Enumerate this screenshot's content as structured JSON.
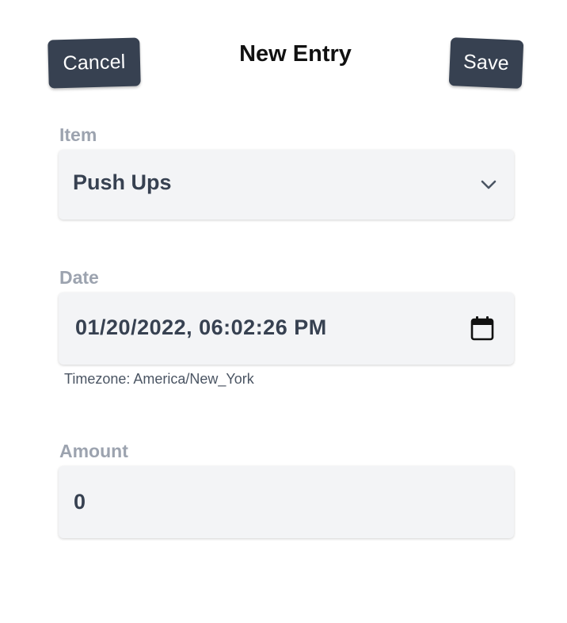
{
  "header": {
    "title": "New Entry",
    "cancel_label": "Cancel",
    "save_label": "Save"
  },
  "form": {
    "item": {
      "label": "Item",
      "value": "Push Ups",
      "icon": "chevron-down-icon"
    },
    "date": {
      "label": "Date",
      "value": "01/20/2022, 06:02:26 PM",
      "icon": "calendar-icon",
      "timezone_hint": "Timezone: America/New_York"
    },
    "amount": {
      "label": "Amount",
      "value": "0"
    }
  },
  "colors": {
    "button_bg": "#374151",
    "field_bg": "#f3f4f6",
    "label_color": "#9ca3af"
  }
}
